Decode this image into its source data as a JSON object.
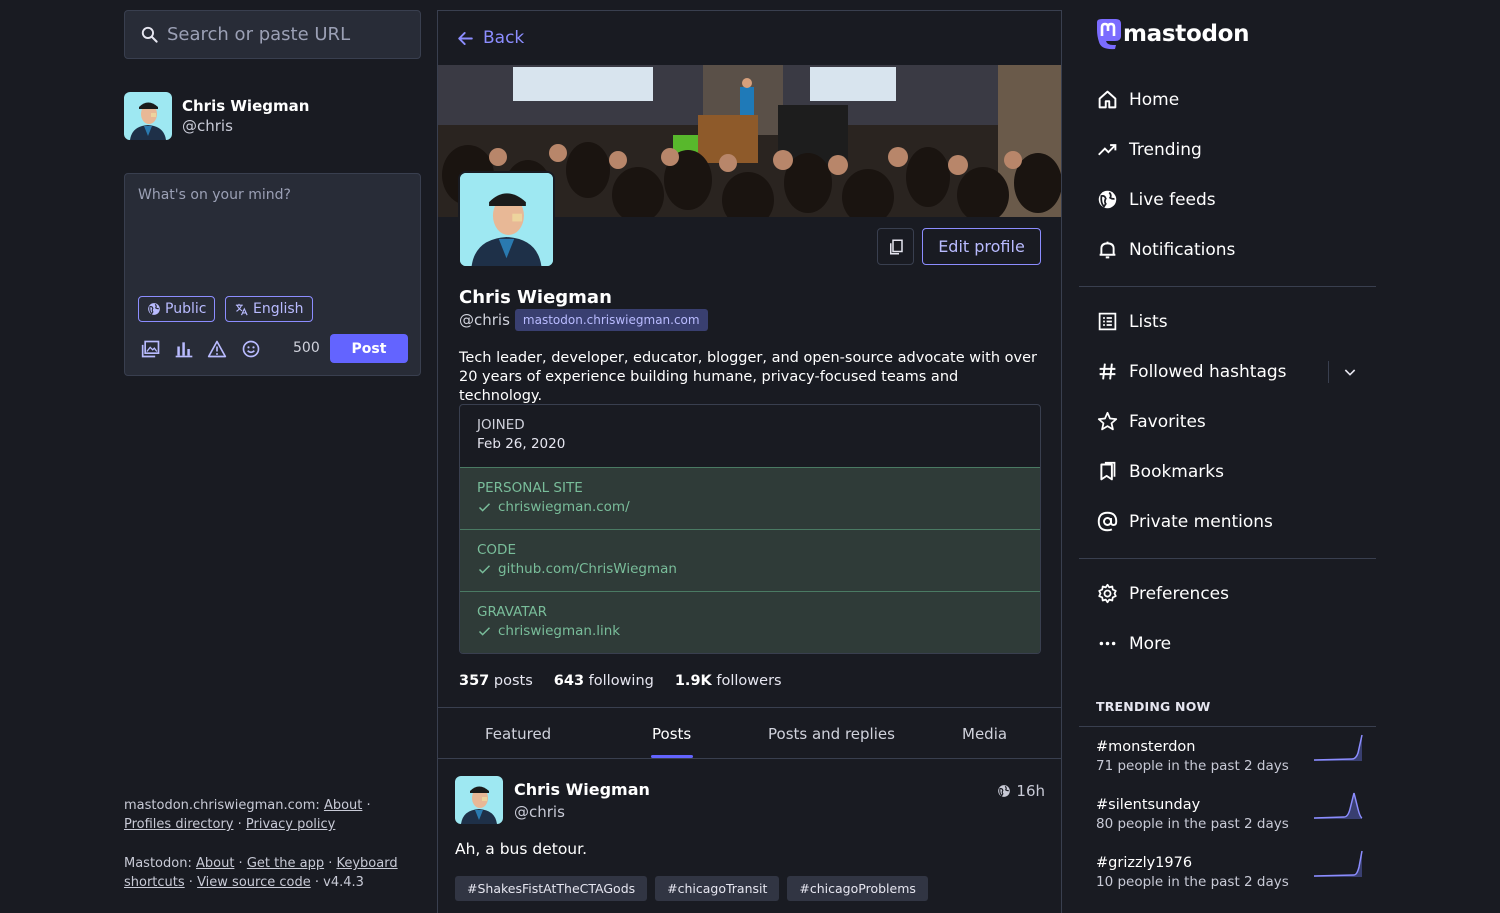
{
  "search": {
    "placeholder": "Search or paste URL"
  },
  "me": {
    "display_name": "Chris Wiegman",
    "handle": "@chris"
  },
  "compose": {
    "placeholder": "What's on your mind?",
    "visibility_label": "Public",
    "language_label": "English",
    "char_count": "500",
    "post_label": "Post"
  },
  "footer": {
    "server_prefix": "mastodon.chriswiegman.com:",
    "about": "About",
    "profiles_directory": "Profiles directory",
    "privacy_policy": "Privacy policy",
    "mastodon_prefix": "Mastodon:",
    "about2": "About",
    "get_app": "Get the app",
    "keyboard": "Keyboard shortcuts",
    "view_source": "View source code",
    "version": "v4.4.3"
  },
  "profile": {
    "back_label": "Back",
    "edit_label": "Edit profile",
    "display_name": "Chris Wiegman",
    "handle": "@chris",
    "domain": "mastodon.chriswiegman.com",
    "bio": "Tech leader, developer, educator, blogger, and open-source advocate with over 20 years of experience building humane, privacy-focused teams and technology.",
    "joined_label": "JOINED",
    "joined_value": "Feb 26, 2020",
    "fields": [
      {
        "label": "PERSONAL SITE",
        "value": "chriswiegman.com/"
      },
      {
        "label": "CODE",
        "value": "github.com/ChrisWiegman"
      },
      {
        "label": "GRAVATAR",
        "value": "chriswiegman.link"
      }
    ],
    "counts": {
      "posts_num": "357",
      "posts_label": "posts",
      "following_num": "643",
      "following_label": "following",
      "followers_num": "1.9K",
      "followers_label": "followers"
    },
    "tabs": [
      "Featured",
      "Posts",
      "Posts and replies",
      "Media"
    ],
    "active_tab": "Posts"
  },
  "status": {
    "display_name": "Chris Wiegman",
    "handle": "@chris",
    "time": "16h",
    "text": "Ah, a bus detour.",
    "tags": [
      "#ShakesFistAtTheCTAGods",
      "#chicagoTransit",
      "#chicagoProblems"
    ]
  },
  "nav": {
    "logo_text": "mastodon",
    "items": [
      "Home",
      "Trending",
      "Live feeds",
      "Notifications",
      "Lists",
      "Followed hashtags",
      "Favorites",
      "Bookmarks",
      "Private mentions",
      "Preferences",
      "More"
    ],
    "icons": [
      "home-icon",
      "trending-icon",
      "globe-icon",
      "bell-icon",
      "list-icon",
      "hashtag-icon",
      "star-icon",
      "bookmark-icon",
      "at-icon",
      "gear-icon",
      "more-icon"
    ]
  },
  "trending": {
    "header": "TRENDING NOW",
    "items": [
      {
        "tag": "#monsterdon",
        "uses": "71 people in the past 2 days"
      },
      {
        "tag": "#silentsunday",
        "uses": "80 people in the past 2 days"
      },
      {
        "tag": "#grizzly1976",
        "uses": "10 people in the past 2 days"
      }
    ]
  },
  "colors": {
    "accent": "#6364ff",
    "accent_light": "#8c8dff",
    "verified": "#79bd9a",
    "bg": "#191b22"
  }
}
